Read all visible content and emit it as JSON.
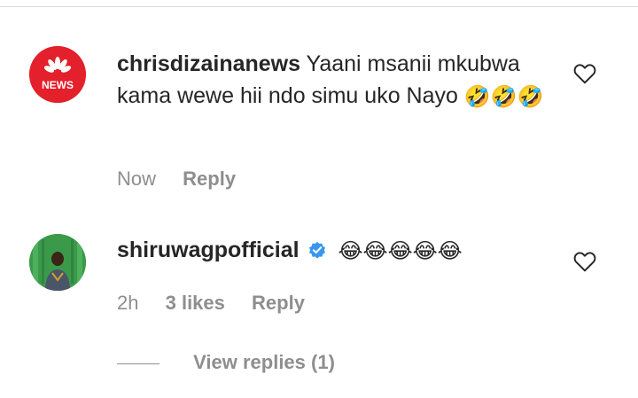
{
  "comments": [
    {
      "username": "chrisdizainanews",
      "text": "Yaani msanii mkubwa kama wewe hii ndo simu uko Nayo",
      "emojis": "🤣🤣🤣",
      "avatar_label": "NEWS",
      "time": "Now",
      "reply_label": "Reply",
      "verified": false
    },
    {
      "username": "shiruwagpofficial",
      "text": "",
      "emojis": "😂😂😂😂😂",
      "time": "2h",
      "likes": "3 likes",
      "reply_label": "Reply",
      "verified": true,
      "view_replies": "View replies (1)"
    }
  ],
  "colors": {
    "text": "#262626",
    "muted": "#8e8e8e",
    "verified": "#3897f0",
    "news_red": "#e3202b"
  },
  "icons": {
    "like": "heart-outline-icon",
    "verified": "verified-badge-icon"
  }
}
